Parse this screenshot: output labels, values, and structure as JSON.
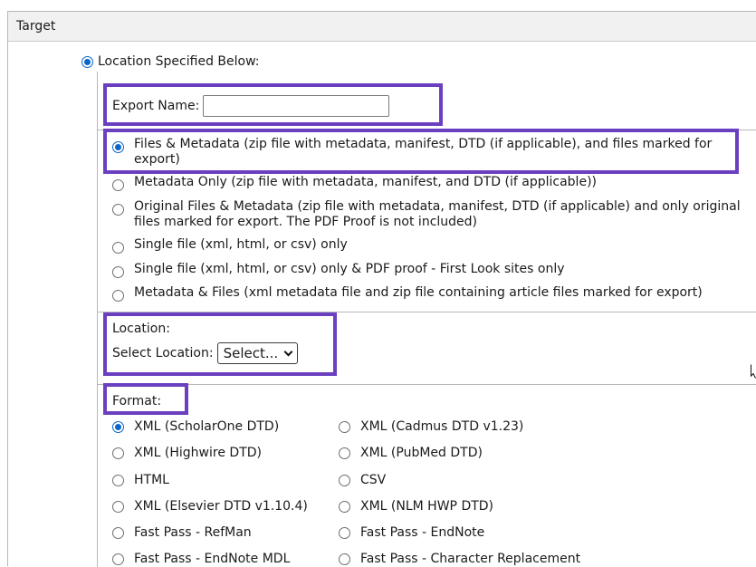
{
  "header": {
    "title": "Target"
  },
  "location_option": {
    "label": "Location Specified Below:"
  },
  "export": {
    "label": "Export Name:",
    "value": ""
  },
  "export_types": [
    {
      "label": "Files & Metadata (zip file with metadata, manifest, DTD (if applicable), and files marked for export)",
      "checked": true
    },
    {
      "label": "Metadata Only (zip file with metadata, manifest, and DTD (if applicable))",
      "checked": false
    },
    {
      "label": "Original Files & Metadata (zip file with metadata, manifest, DTD (if applicable) and only original files marked for export. The PDF Proof is not included)",
      "checked": false
    },
    {
      "label": "Single file (xml, html, or csv) only",
      "checked": false
    },
    {
      "label": "Single file (xml, html, or csv) only & PDF proof - First Look sites only",
      "checked": false
    },
    {
      "label": "Metadata & Files (xml metadata file and zip file containing article files marked for export)",
      "checked": false
    }
  ],
  "location_section": {
    "title": "Location:",
    "select_label": "Select Location:",
    "select_value": "Select..."
  },
  "format": {
    "title": "Format:",
    "options": [
      {
        "label": "XML (ScholarOne DTD)",
        "checked": true
      },
      {
        "label": "XML (Cadmus DTD v1.23)",
        "checked": false
      },
      {
        "label": "XML (Highwire DTD)",
        "checked": false
      },
      {
        "label": "XML (PubMed DTD)",
        "checked": false
      },
      {
        "label": "HTML",
        "checked": false
      },
      {
        "label": "CSV",
        "checked": false
      },
      {
        "label": "XML (Elsevier DTD v1.10.4)",
        "checked": false
      },
      {
        "label": "XML (NLM HWP DTD)",
        "checked": false
      },
      {
        "label": "Fast Pass - RefMan",
        "checked": false
      },
      {
        "label": "Fast Pass - EndNote",
        "checked": false
      },
      {
        "label": "Fast Pass - EndNote MDL",
        "checked": false
      },
      {
        "label": "Fast Pass - Character Replacement",
        "checked": false
      }
    ]
  },
  "colors": {
    "highlight": "#6a3fc0",
    "radio_accent": "#0a66c9"
  }
}
